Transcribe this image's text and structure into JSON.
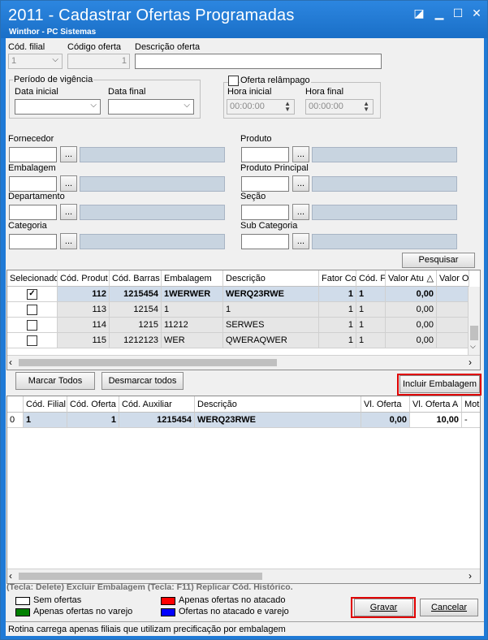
{
  "window": {
    "title": "2011 - Cadastrar Ofertas Programadas",
    "subtitle": "Winthor - PC Sistemas",
    "buttons": {
      "restore": "◪",
      "minimize": "▁",
      "maximize": "☐",
      "close": "✕"
    }
  },
  "filters": {
    "cod_filial_label": "Cód. filial",
    "cod_filial_value": "1",
    "codigo_oferta_label": "Código oferta",
    "codigo_oferta_value": "1",
    "descricao_oferta_label": "Descrição oferta",
    "descricao_oferta_value": "",
    "periodo_vigencia_label": "Período de vigência",
    "data_inicial_label": "Data inicial",
    "data_final_label": "Data final",
    "oferta_relampago_label": "Oferta relâmpago",
    "hora_inicial_label": "Hora inicial",
    "hora_inicial_value": "00:00:00",
    "hora_final_label": "Hora final",
    "hora_final_value": "00:00:00",
    "fornecedor_label": "Fornecedor",
    "produto_label": "Produto",
    "embalagem_label": "Embalagem",
    "produto_principal_label": "Produto Principal",
    "departamento_label": "Departamento",
    "secao_label": "Seção",
    "categoria_label": "Categoria",
    "sub_categoria_label": "Sub Categoria",
    "browse_label": "...",
    "pesquisar_label": "Pesquisar"
  },
  "products_grid": {
    "columns": [
      "Selecionado",
      "Cód. Produt",
      "Cód. Barras",
      "Embalagem",
      "Descrição",
      "Fator Co",
      "Cód. F",
      "Valor Atu",
      "Valor O"
    ],
    "rows": [
      {
        "selected": "✓",
        "cod": "112",
        "barras": "1215454",
        "emb": "1WERWER",
        "desc": "WERQ23RWE",
        "fator": "1",
        "codf": "1",
        "valor": "0,00"
      },
      {
        "selected": "",
        "cod": "113",
        "barras": "12154",
        "emb": "1",
        "desc": "1",
        "fator": "1",
        "codf": "1",
        "valor": "0,00"
      },
      {
        "selected": "",
        "cod": "114",
        "barras": "1215",
        "emb": "11212",
        "desc": "SERWES",
        "fator": "1",
        "codf": "1",
        "valor": "0,00"
      },
      {
        "selected": "",
        "cod": "115",
        "barras": "1212123",
        "emb": "WER",
        "desc": "QWERAQWER",
        "fator": "1",
        "codf": "1",
        "valor": "0,00"
      }
    ],
    "sort_glyph": "△"
  },
  "actions": {
    "marcar_todos": "Marcar Todos",
    "desmarcar_todos": "Desmarcar todos",
    "incluir_embalagem": "Incluir Embalagem"
  },
  "offers_grid": {
    "columns": [
      "Cód. Filial",
      "Cód. Oferta",
      "Cód. Auxiliar",
      "Descrição",
      "Vl. Oferta",
      "Vl. Oferta A",
      "Motiv"
    ],
    "rows": [
      {
        "idx": "0",
        "filial": "1",
        "oferta": "1",
        "auxiliar": "1215454",
        "desc": "WERQ23RWE",
        "vl": "0,00",
        "vla": "10,00",
        "motivo": "-"
      }
    ]
  },
  "hints": "(Tecla: Delete) Excluir Embalagem   (Tecla: F11) Replicar Cód. Histórico.",
  "legend": [
    {
      "label": "Sem ofertas",
      "color": "#ffffff"
    },
    {
      "label": "Apenas ofertas no atacado",
      "color": "#ff0000"
    },
    {
      "label": "Apenas ofertas no varejo",
      "color": "#008000"
    },
    {
      "label": "Ofertas no atacado e varejo",
      "color": "#0000ff"
    }
  ],
  "footer": {
    "gravar": "Gravar",
    "cancelar": "Cancelar",
    "status": "Rotina carrega apenas filiais que utilizam precificação por embalagem"
  }
}
